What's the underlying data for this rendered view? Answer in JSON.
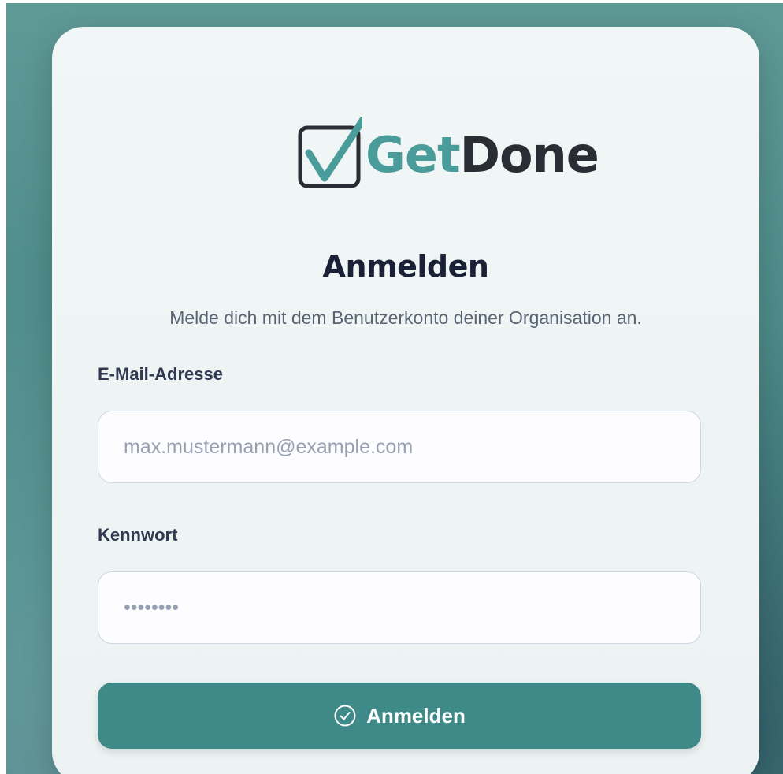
{
  "brand": {
    "name_part1": "Get",
    "name_part2": "Done",
    "accent_color": "#4a9c9a",
    "dark_color": "#2a2d33",
    "logo_icon": "checkbox-check-icon"
  },
  "login": {
    "title": "Anmelden",
    "subtitle": "Melde dich mit dem Benutzerkonto deiner Organisation an.",
    "email_label": "E-Mail-Adresse",
    "email_placeholder": "max.mustermann@example.com",
    "email_value": "",
    "password_label": "Kennwort",
    "password_placeholder": "••••••••",
    "password_value": "",
    "submit_label": "Anmelden",
    "submit_icon": "check-circle-icon",
    "button_color": "#3d8a89"
  }
}
